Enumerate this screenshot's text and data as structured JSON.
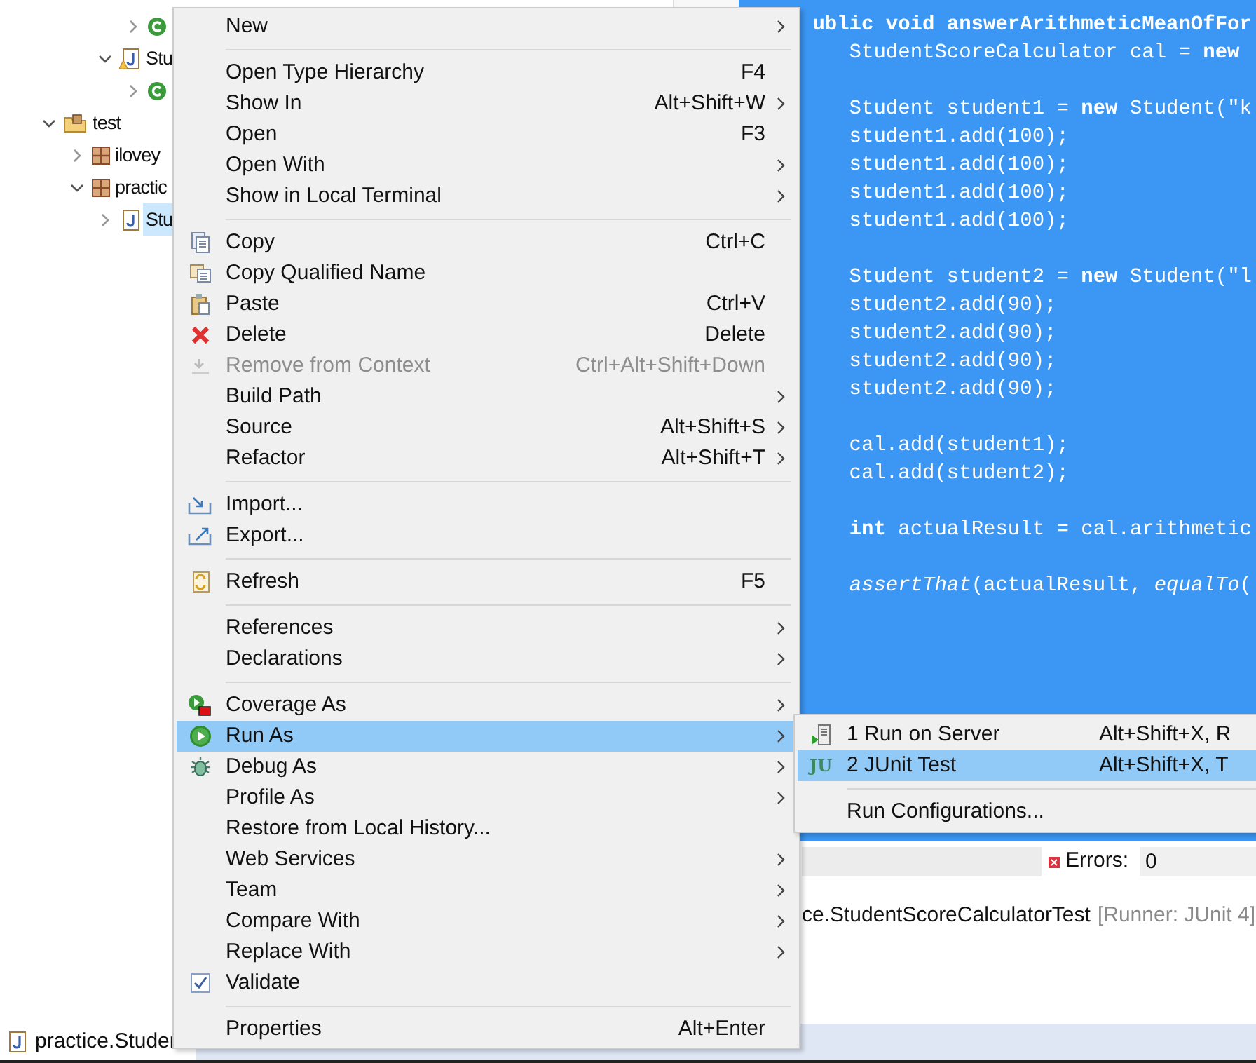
{
  "tree": [
    {
      "kind": "scrolled-off",
      "children": [
        {
          "kind": "scrolled-off",
          "children": [
            {
              "kind": "scrolled-off",
              "children": [
                {
                  "kind": "class",
                  "expanded": false
                }
              ]
            },
            {
              "kind": "java-warning",
              "label": "Stu",
              "expanded": true,
              "selected": false,
              "children": [
                {
                  "kind": "class",
                  "expanded": false
                }
              ]
            }
          ]
        }
      ]
    },
    {
      "kind": "source-folder",
      "label": "test",
      "expanded": true,
      "selected": false,
      "children": [
        {
          "kind": "package",
          "label": "ilovey",
          "expanded": false,
          "selected": false
        },
        {
          "kind": "package",
          "label": "practic",
          "expanded": true,
          "selected": false,
          "children": [
            {
              "kind": "java",
              "label": "Stu",
              "expanded": false,
              "selected": true
            }
          ]
        }
      ]
    }
  ],
  "code_lines": [
    {
      "kind": "partial",
      "text": "ublic void answerArithmeticMeanOfFor"
    },
    {
      "kind": "code",
      "text": "    StudentScoreCalculator cal = **new**"
    },
    {
      "kind": "blank"
    },
    {
      "kind": "code",
      "text": "    Student student1 = **new** Student(\"k"
    },
    {
      "kind": "code",
      "text": "    student1.add(100);"
    },
    {
      "kind": "code",
      "text": "    student1.add(100);"
    },
    {
      "kind": "code",
      "text": "    student1.add(100);"
    },
    {
      "kind": "code",
      "text": "    student1.add(100);"
    },
    {
      "kind": "blank"
    },
    {
      "kind": "code",
      "text": "    Student student2 = **new** Student(\"l"
    },
    {
      "kind": "code",
      "text": "    student2.add(90);"
    },
    {
      "kind": "code",
      "text": "    student2.add(90);"
    },
    {
      "kind": "code",
      "text": "    student2.add(90);"
    },
    {
      "kind": "code",
      "text": "    student2.add(90);"
    },
    {
      "kind": "blank"
    },
    {
      "kind": "code",
      "text": "    cal.add(student1);"
    },
    {
      "kind": "code",
      "text": "    cal.add(student2);"
    },
    {
      "kind": "blank"
    },
    {
      "kind": "code",
      "text": "    **int** actualResult = cal.arithmetic"
    },
    {
      "kind": "blank"
    },
    {
      "kind": "code",
      "text": "    *assertThat*(actualResult, *equalTo*("
    }
  ],
  "context_menu": [
    {
      "kind": "plain",
      "label": "New",
      "submenu": true,
      "selected": false
    },
    {
      "kind": "separator"
    },
    {
      "kind": "plain",
      "label": "Open Type Hierarchy",
      "shortcut": "F4",
      "submenu": false,
      "selected": false
    },
    {
      "kind": "plain",
      "label": "Show In",
      "shortcut": "Alt+Shift+W",
      "submenu": true,
      "selected": false
    },
    {
      "kind": "plain",
      "label": "Open",
      "shortcut": "F3",
      "submenu": false,
      "selected": false
    },
    {
      "kind": "plain",
      "label": "Open With",
      "submenu": true,
      "selected": false
    },
    {
      "kind": "plain",
      "label": "Show in Local Terminal",
      "submenu": true,
      "selected": false
    },
    {
      "kind": "separator"
    },
    {
      "kind": "copy",
      "label": "Copy",
      "shortcut": "Ctrl+C",
      "submenu": false,
      "selected": false
    },
    {
      "kind": "copyname",
      "label": "Copy Qualified Name",
      "submenu": false,
      "selected": false
    },
    {
      "kind": "paste",
      "label": "Paste",
      "shortcut": "Ctrl+V",
      "submenu": false,
      "selected": false
    },
    {
      "kind": "delete",
      "label": "Delete",
      "shortcut": "Delete",
      "submenu": false,
      "selected": false
    },
    {
      "kind": "remove",
      "label": "Remove from Context",
      "shortcut": "Ctrl+Alt+Shift+Down",
      "submenu": false,
      "disabled": true,
      "selected": false
    },
    {
      "kind": "plain",
      "label": "Build Path",
      "submenu": true,
      "selected": false
    },
    {
      "kind": "plain",
      "label": "Source",
      "shortcut": "Alt+Shift+S",
      "submenu": true,
      "selected": false
    },
    {
      "kind": "plain",
      "label": "Refactor",
      "shortcut": "Alt+Shift+T",
      "submenu": true,
      "selected": false
    },
    {
      "kind": "separator"
    },
    {
      "kind": "import",
      "label": "Import...",
      "submenu": false,
      "selected": false
    },
    {
      "kind": "export",
      "label": "Export...",
      "submenu": false,
      "selected": false
    },
    {
      "kind": "separator"
    },
    {
      "kind": "refresh",
      "label": "Refresh",
      "shortcut": "F5",
      "submenu": false,
      "selected": false
    },
    {
      "kind": "separator"
    },
    {
      "kind": "plain",
      "label": "References",
      "submenu": true,
      "selected": false
    },
    {
      "kind": "plain",
      "label": "Declarations",
      "submenu": true,
      "selected": false
    },
    {
      "kind": "separator"
    },
    {
      "kind": "coverage",
      "label": "Coverage As",
      "submenu": true,
      "selected": false
    },
    {
      "kind": "run",
      "label": "Run As",
      "submenu": true,
      "selected": true
    },
    {
      "kind": "debug",
      "label": "Debug As",
      "submenu": true,
      "selected": false
    },
    {
      "kind": "plain",
      "label": "Profile As",
      "submenu": true,
      "selected": false
    },
    {
      "kind": "plain",
      "label": "Restore from Local History...",
      "submenu": false,
      "selected": false
    },
    {
      "kind": "plain",
      "label": "Web Services",
      "submenu": true,
      "selected": false
    },
    {
      "kind": "plain",
      "label": "Team",
      "submenu": true,
      "selected": false
    },
    {
      "kind": "plain",
      "label": "Compare With",
      "submenu": true,
      "selected": false
    },
    {
      "kind": "plain",
      "label": "Replace With",
      "submenu": true,
      "selected": false
    },
    {
      "kind": "check",
      "label": "Validate",
      "submenu": false,
      "selected": false
    },
    {
      "kind": "separator"
    },
    {
      "kind": "plain",
      "label": "Properties",
      "shortcut": "Alt+Enter",
      "submenu": false,
      "selected": false
    }
  ],
  "run_as_submenu": [
    {
      "kind": "server",
      "label": "1 Run on Server",
      "shortcut": "Alt+Shift+X, R",
      "selected": false
    },
    {
      "kind": "junit",
      "label": "2 JUnit Test",
      "shortcut": "Alt+Shift+X, T",
      "icon_text": "JU",
      "selected": true
    },
    {
      "kind": "separator"
    },
    {
      "kind": "plain",
      "label": "Run Configurations...",
      "selected": false
    }
  ],
  "junit_panel": {
    "errors_label": "Errors:",
    "errors_value": "0",
    "test_name": "ce.StudentScoreCalculatorTest",
    "runner": "[Runner: JUnit 4]"
  },
  "status_tab": {
    "label": "practice.Studer"
  }
}
